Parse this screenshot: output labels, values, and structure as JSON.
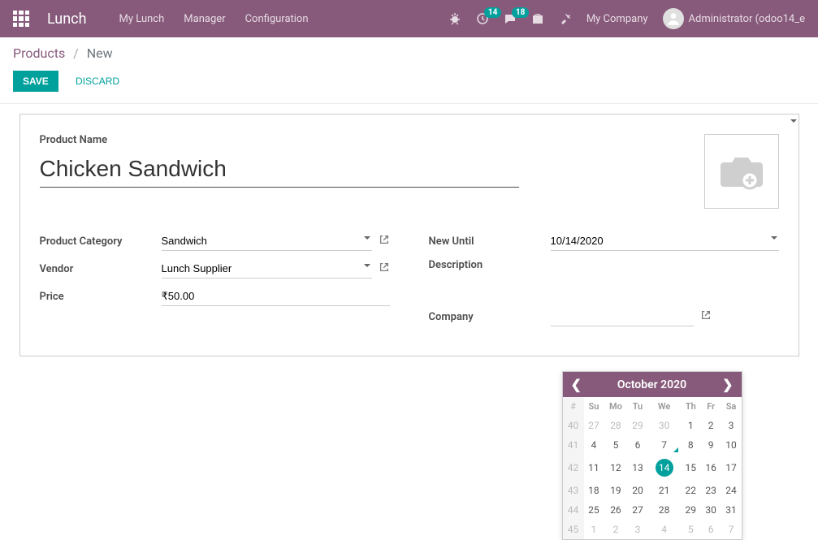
{
  "nav": {
    "brand": "Lunch",
    "menu": [
      "My Lunch",
      "Manager",
      "Configuration"
    ],
    "activities_count": "14",
    "discuss_count": "18",
    "company": "My Company",
    "user": "Administrator (odoo14_e"
  },
  "breadcrumb": {
    "parent": "Products",
    "current": "New"
  },
  "buttons": {
    "save": "Save",
    "discard": "Discard"
  },
  "form": {
    "product_name_label": "Product Name",
    "product_name": "Chicken Sandwich",
    "category_label": "Product Category",
    "category": "Sandwich",
    "vendor_label": "Vendor",
    "vendor": "Lunch Supplier",
    "price_label": "Price",
    "price": "₹50.00",
    "new_until_label": "New Until",
    "new_until": "10/14/2020",
    "description_label": "Description",
    "company_label": "Company"
  },
  "datepicker": {
    "title": "October 2020",
    "dow": [
      "#",
      "Su",
      "Mo",
      "Tu",
      "We",
      "Th",
      "Fr",
      "Sa"
    ],
    "weeks": [
      {
        "wk": "40",
        "days": [
          {
            "d": "27",
            "o": true
          },
          {
            "d": "28",
            "o": true
          },
          {
            "d": "29",
            "o": true
          },
          {
            "d": "30",
            "o": true
          },
          {
            "d": "1"
          },
          {
            "d": "2"
          },
          {
            "d": "3"
          }
        ]
      },
      {
        "wk": "41",
        "days": [
          {
            "d": "4"
          },
          {
            "d": "5"
          },
          {
            "d": "6"
          },
          {
            "d": "7",
            "today": true
          },
          {
            "d": "8"
          },
          {
            "d": "9"
          },
          {
            "d": "10"
          }
        ]
      },
      {
        "wk": "42",
        "days": [
          {
            "d": "11"
          },
          {
            "d": "12"
          },
          {
            "d": "13"
          },
          {
            "d": "14",
            "sel": true
          },
          {
            "d": "15"
          },
          {
            "d": "16"
          },
          {
            "d": "17"
          }
        ]
      },
      {
        "wk": "43",
        "days": [
          {
            "d": "18"
          },
          {
            "d": "19"
          },
          {
            "d": "20"
          },
          {
            "d": "21"
          },
          {
            "d": "22"
          },
          {
            "d": "23"
          },
          {
            "d": "24"
          }
        ]
      },
      {
        "wk": "44",
        "days": [
          {
            "d": "25"
          },
          {
            "d": "26"
          },
          {
            "d": "27"
          },
          {
            "d": "28"
          },
          {
            "d": "29"
          },
          {
            "d": "30"
          },
          {
            "d": "31"
          }
        ]
      },
      {
        "wk": "45",
        "days": [
          {
            "d": "1",
            "o": true
          },
          {
            "d": "2",
            "o": true
          },
          {
            "d": "3",
            "o": true
          },
          {
            "d": "4",
            "o": true
          },
          {
            "d": "5",
            "o": true
          },
          {
            "d": "6",
            "o": true
          },
          {
            "d": "7",
            "o": true
          }
        ]
      }
    ]
  }
}
